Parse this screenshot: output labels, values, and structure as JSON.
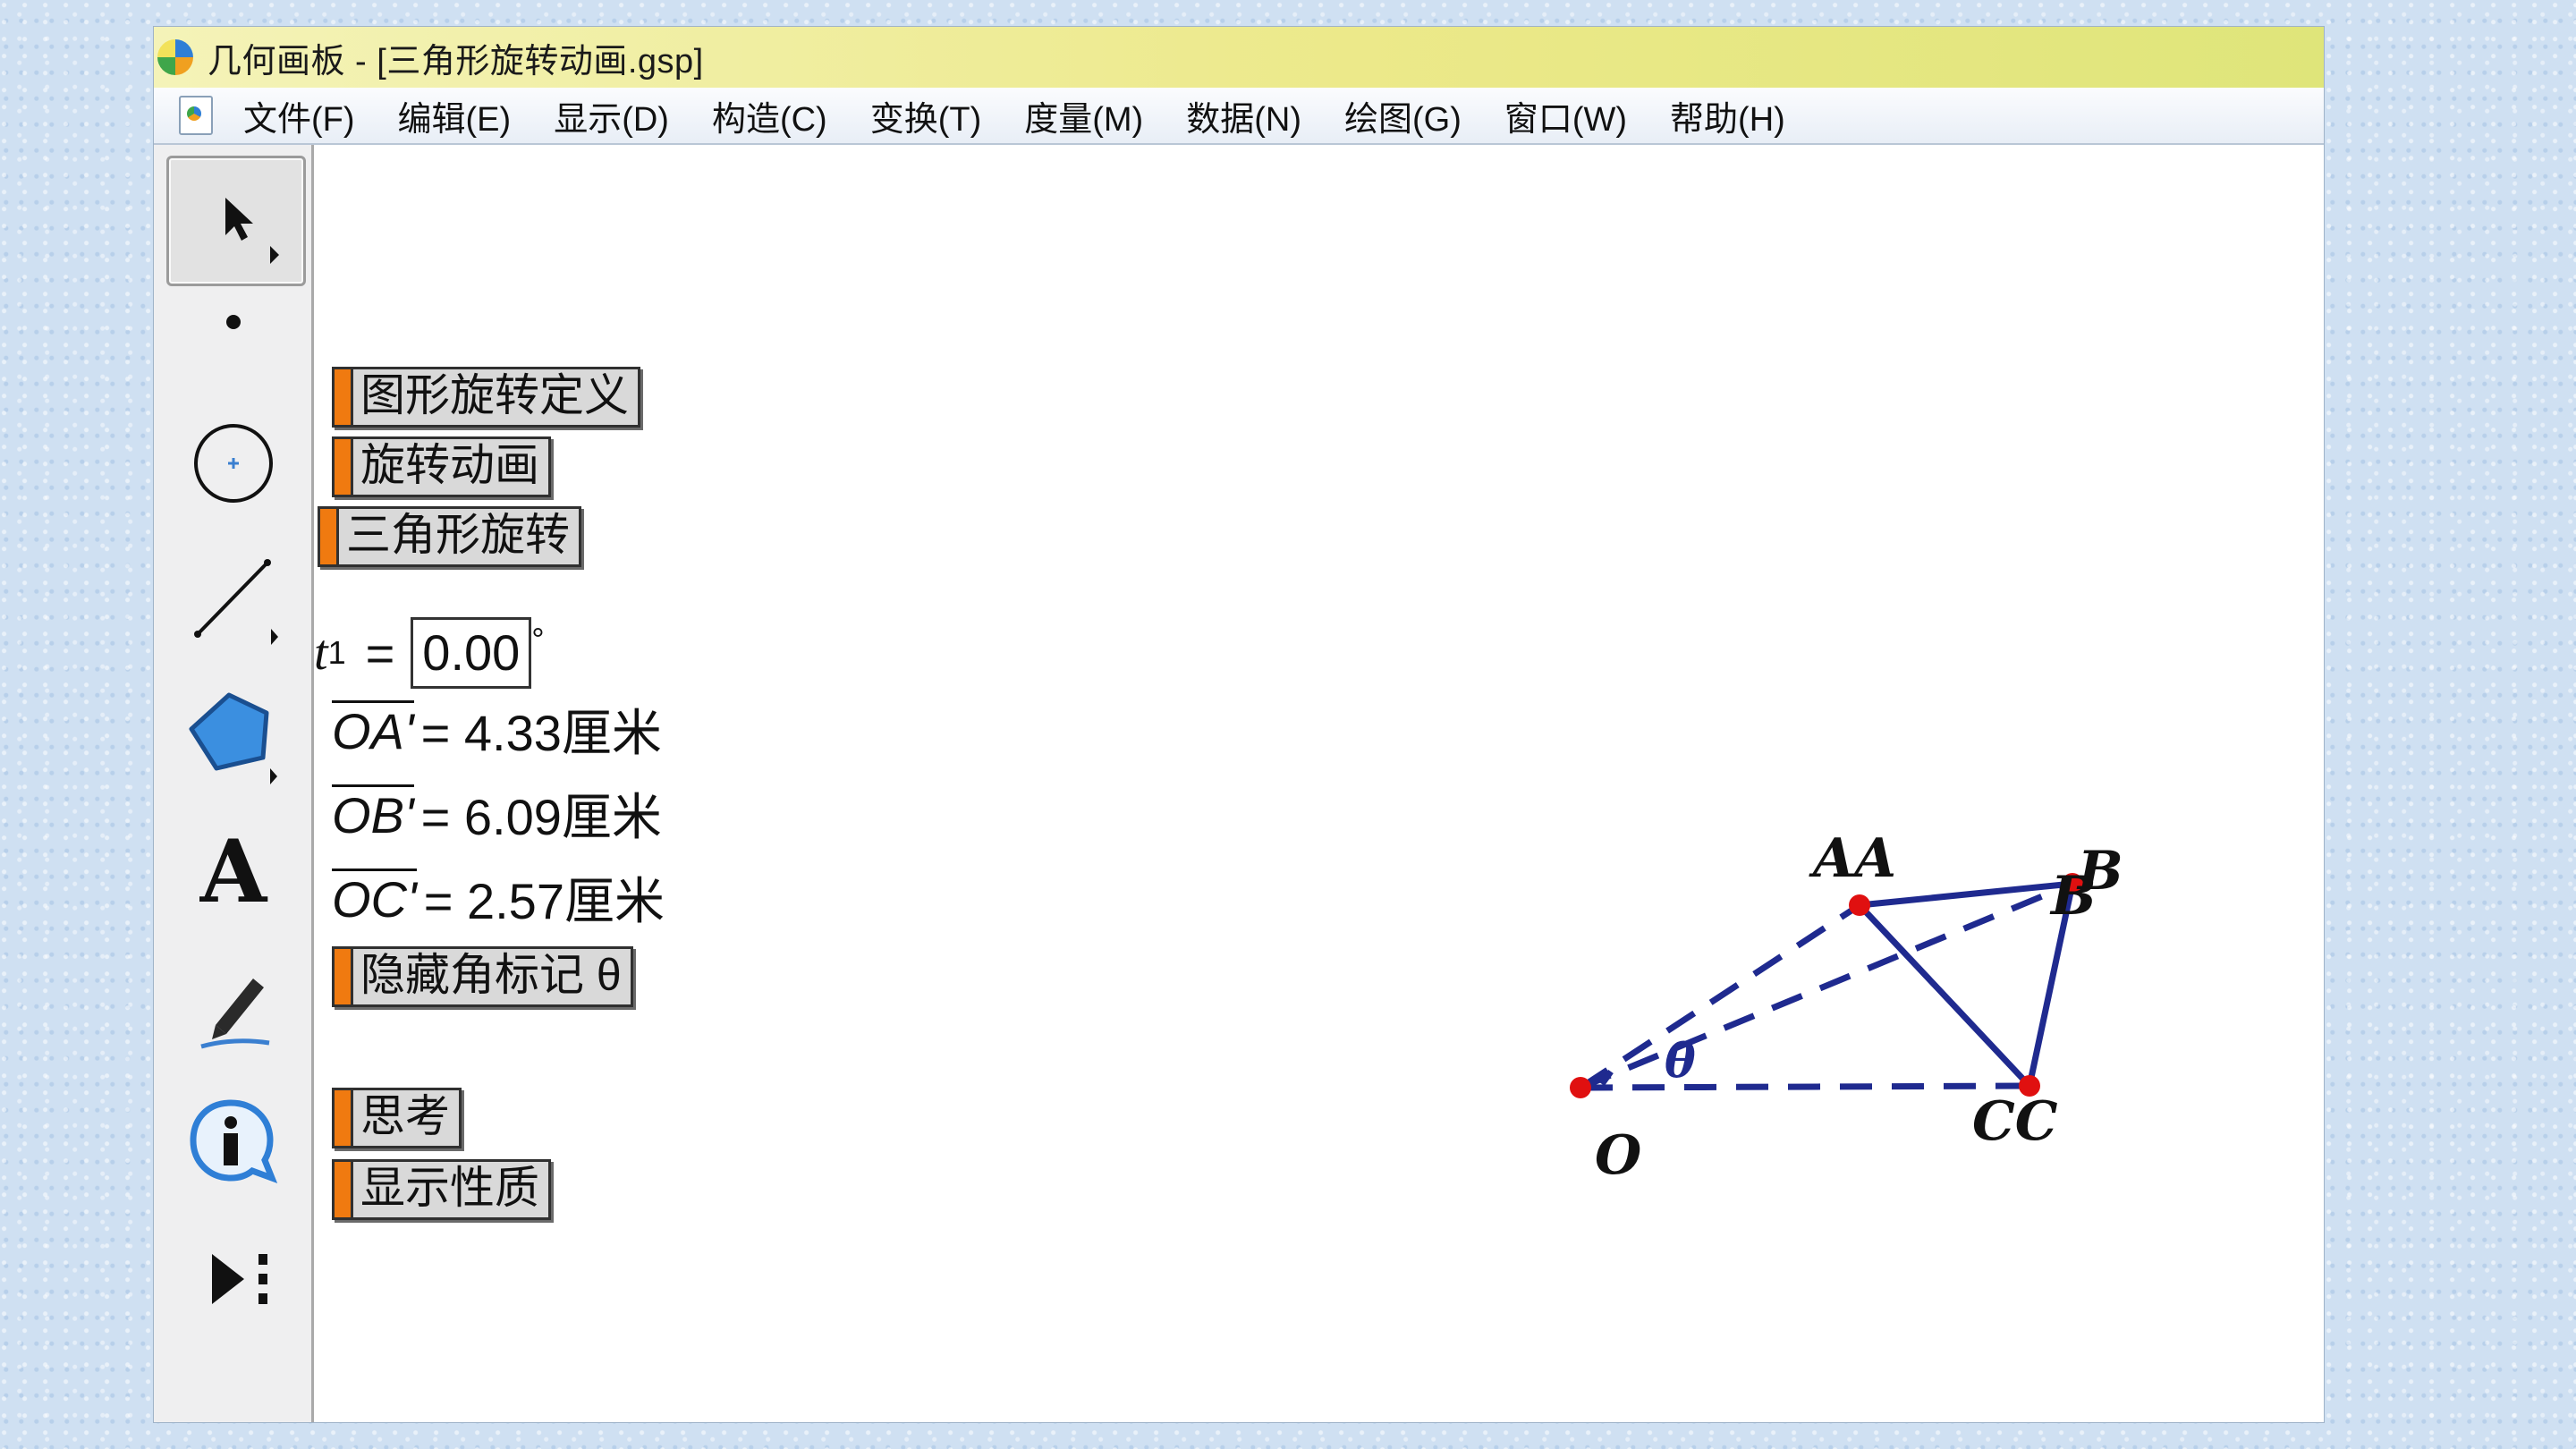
{
  "window": {
    "title": "几何画板 - [三角形旋转动画.gsp]"
  },
  "menu": [
    "文件(F)",
    "编辑(E)",
    "显示(D)",
    "构造(C)",
    "变换(T)",
    "度量(M)",
    "数据(N)",
    "绘图(G)",
    "窗口(W)",
    "帮助(H)"
  ],
  "tools": [
    "arrow-select-icon",
    "point-icon",
    "compass-circle-icon",
    "straightedge-line-icon",
    "polygon-icon",
    "text-a-icon",
    "marker-pen-icon",
    "info-icon",
    "custom-tool-icon"
  ],
  "buttons": {
    "rotation_definition": "图形旋转定义",
    "rotation_animation": "旋转动画",
    "triangle_rotation": "三角形旋转",
    "hide_angle_mark": "隐藏角标记 θ",
    "think": "思考",
    "show_properties": "显示性质"
  },
  "parameter": {
    "name": "t",
    "subscript": "1",
    "value": "0.00",
    "unit": "°"
  },
  "measurements": [
    {
      "segment": "OA'",
      "value": "= 4.33厘米"
    },
    {
      "segment": "OB'",
      "value": "= 6.09厘米"
    },
    {
      "segment": "OC'",
      "value": "= 2.57厘米"
    }
  ],
  "figure": {
    "labels": {
      "O": "O",
      "A": "AA",
      "B_top": "B",
      "B_bottom": "B",
      "C": "CC",
      "theta": "θ"
    },
    "colors": {
      "line": "#1f2a8f",
      "point": "#e01010"
    }
  }
}
